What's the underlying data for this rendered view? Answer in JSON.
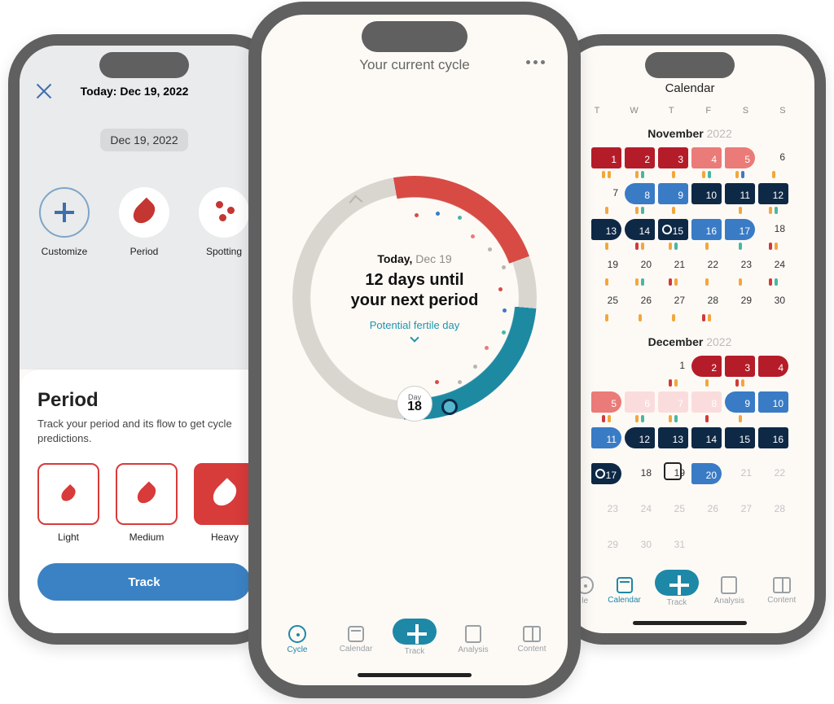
{
  "colors": {
    "red": "#D84B45",
    "darkred": "#B51C29",
    "pink": "#EB7B78",
    "softpink": "#FBDCDC",
    "blue": "#3A7BC6",
    "navy": "#0E2946",
    "teal": "#1E88A7",
    "grey": "#d9d6d0"
  },
  "left": {
    "close_label": "Close",
    "today_hdr": "Today: Dec 19, 2022",
    "date_chip": "Dec 19, 2022",
    "icons": {
      "customize": "Customize",
      "period": "Period",
      "spotting": "Spotting"
    },
    "sheet": {
      "title": "Period",
      "subtitle": "Track your period and its flow to get cycle predictions.",
      "options": {
        "light": "Light",
        "medium": "Medium",
        "heavy": "Heavy"
      },
      "track_button": "Track"
    }
  },
  "center": {
    "title": "Your current cycle",
    "more_label": "More",
    "today_label": "Today,",
    "today_date": "Dec 19",
    "countdown": "12 days until your next period",
    "fertile_label": "Potential fertile day",
    "day_chip_label": "Day",
    "day_chip_value": "18",
    "nav": {
      "cycle": "Cycle",
      "calendar": "Calendar",
      "track": "Track",
      "analysis": "Analysis",
      "content": "Content"
    }
  },
  "right": {
    "title": "Calendar",
    "dow": [
      "T",
      "W",
      "T",
      "F",
      "S",
      "S"
    ],
    "nov_label": "November",
    "nov_year": "2022",
    "dec_label": "December",
    "dec_year": "2022",
    "nav": {
      "calendar": "Calendar",
      "track": "Track",
      "analysis": "Analysis",
      "content": "Content"
    },
    "nov": [
      {
        "n": 1,
        "bg": "rd",
        "d": [
          "o",
          "o"
        ]
      },
      {
        "n": 2,
        "bg": "rd",
        "d": [
          "o",
          "g"
        ]
      },
      {
        "n": 3,
        "bg": "rd",
        "d": [
          "o"
        ]
      },
      {
        "n": 4,
        "bg": "rd2",
        "d": [
          "o",
          "g"
        ]
      },
      {
        "n": 5,
        "bg": "rd2",
        "rad": "r",
        "d": [
          "o",
          "b"
        ]
      },
      {
        "n": 6,
        "plain": true,
        "d": [
          "o"
        ]
      },
      {
        "n": 7,
        "plain": true,
        "d": [
          "o"
        ]
      },
      {
        "n": 8,
        "bg": "bl",
        "rad": "l",
        "d": [
          "o",
          "g"
        ]
      },
      {
        "n": 9,
        "bg": "bl",
        "d": [
          "o"
        ]
      },
      {
        "n": 10,
        "bg": "nv"
      },
      {
        "n": 11,
        "bg": "nv",
        "d": [
          "o"
        ]
      },
      {
        "n": 12,
        "bg": "nv",
        "d": [
          "o",
          "g"
        ]
      },
      {
        "n": 13,
        "bg": "nv",
        "rad": "r",
        "d": [
          "o"
        ]
      },
      {
        "n": 14,
        "bg": "nv",
        "rad": "l",
        "d": [
          "r",
          "o"
        ]
      },
      {
        "n": 15,
        "bg": "nv",
        "open": true,
        "d": [
          "o",
          "g"
        ]
      },
      {
        "n": 16,
        "bg": "bl",
        "d": [
          "o"
        ]
      },
      {
        "n": 17,
        "bg": "bl",
        "rad": "r",
        "d": [
          "g"
        ]
      },
      {
        "n": 18,
        "plain": true,
        "d": [
          "r",
          "o"
        ]
      },
      {
        "n": 19,
        "plain": true,
        "d": [
          "o"
        ]
      },
      {
        "n": 20,
        "plain": true,
        "d": [
          "o",
          "g"
        ]
      },
      {
        "n": 21,
        "plain": true,
        "d": [
          "r",
          "o"
        ]
      },
      {
        "n": 22,
        "plain": true,
        "d": [
          "o"
        ]
      },
      {
        "n": 23,
        "plain": true,
        "d": [
          "o"
        ]
      },
      {
        "n": 24,
        "plain": true,
        "d": [
          "r",
          "g"
        ]
      },
      {
        "n": 25,
        "plain": true,
        "d": [
          "o"
        ]
      },
      {
        "n": 26,
        "plain": true,
        "d": [
          "o"
        ]
      },
      {
        "n": 27,
        "plain": true,
        "d": [
          "o"
        ]
      },
      {
        "n": 28,
        "plain": true,
        "d": [
          "r",
          "o"
        ]
      },
      {
        "n": 29,
        "plain": true
      },
      {
        "n": 30,
        "plain": true
      }
    ],
    "dec": [
      {
        "empty": true
      },
      {
        "empty": true
      },
      {
        "n": 1,
        "plain": true,
        "d": [
          "r",
          "o"
        ]
      },
      {
        "n": 2,
        "bg": "rd",
        "rad": "l",
        "d": [
          "o"
        ]
      },
      {
        "n": 3,
        "bg": "rd",
        "d": [
          "r",
          "o"
        ]
      },
      {
        "n": 4,
        "bg": "rd",
        "rad": "r"
      },
      {
        "n": 5,
        "bg": "rd2",
        "rad": "r",
        "d": [
          "r",
          "o"
        ]
      },
      {
        "n": 6,
        "bg": "pk",
        "d": [
          "o",
          "g"
        ]
      },
      {
        "n": 7,
        "bg": "pk",
        "d": [
          "o",
          "g"
        ]
      },
      {
        "n": 8,
        "bg": "pk",
        "d": [
          "r"
        ]
      },
      {
        "n": 9,
        "bg": "bl",
        "rad": "l",
        "d": [
          "o"
        ]
      },
      {
        "n": 10,
        "bg": "bl"
      },
      {
        "n": 11,
        "bg": "bl",
        "rad": "r"
      },
      {
        "n": 12,
        "bg": "nv",
        "rad": "l"
      },
      {
        "n": 13,
        "bg": "nv"
      },
      {
        "n": 14,
        "bg": "nv"
      },
      {
        "n": 15,
        "bg": "nv"
      },
      {
        "n": 16,
        "bg": "nv"
      },
      {
        "n": 17,
        "bg": "nv",
        "open": true,
        "rad": "r"
      },
      {
        "n": 18,
        "plain": true
      },
      {
        "n": 19,
        "plain": true,
        "today": true
      },
      {
        "n": 20,
        "bg": "bl",
        "rad": "r"
      },
      {
        "n": 21,
        "plain": true,
        "dim": true
      },
      {
        "n": 22,
        "plain": true,
        "dim": true
      },
      {
        "n": 23,
        "plain": true,
        "dim": true
      },
      {
        "n": 24,
        "plain": true,
        "dim": true
      },
      {
        "n": 25,
        "plain": true,
        "dim": true
      },
      {
        "n": 26,
        "plain": true,
        "dim": true
      },
      {
        "n": 27,
        "plain": true,
        "dim": true
      },
      {
        "n": 28,
        "plain": true,
        "dim": true
      },
      {
        "n": 29,
        "plain": true,
        "dim": true
      },
      {
        "n": 30,
        "plain": true,
        "dim": true
      },
      {
        "n": 31,
        "plain": true,
        "dim": true,
        "red31": true
      }
    ]
  }
}
